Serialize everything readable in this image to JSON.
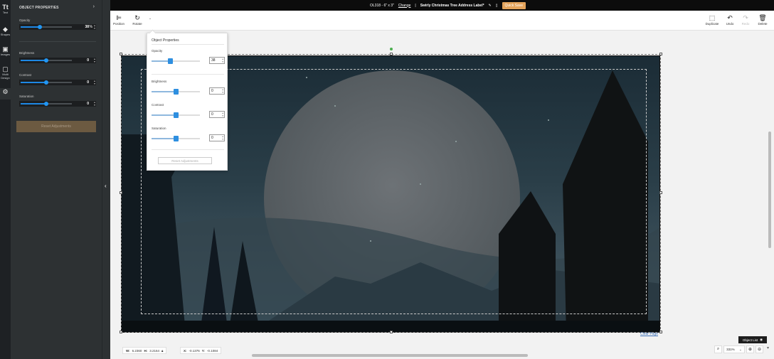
{
  "topbar": {
    "product_code": "OL318 - 6\" x 3\"",
    "change_label": "Change",
    "separator": "|",
    "design_title": "Swirly Christmas Tree Address Label*",
    "quick_save_label": "Quick Save"
  },
  "rail": {
    "items": [
      {
        "label": "Text",
        "icon": "Tt"
      },
      {
        "label": "Shapes",
        "icon": "shapes-icon"
      },
      {
        "label": "Images",
        "icon": "image-icon"
      },
      {
        "label": "Multi Design",
        "icon": "page-icon"
      },
      {
        "label": "",
        "icon": "gear-icon"
      }
    ]
  },
  "panel": {
    "header": "OBJECT PROPERTIES",
    "opacity": {
      "label": "Opacity",
      "value": "38",
      "unit": "%",
      "level": 0.38
    },
    "brightness": {
      "label": "Brightness",
      "value": "0",
      "level": 0.5
    },
    "contrast": {
      "label": "Contrast",
      "value": "0",
      "level": 0.5
    },
    "saturation": {
      "label": "Saturation",
      "value": "0",
      "level": 0.5
    },
    "reset_label": "Reset Adjustments"
  },
  "toolbar": {
    "position_label": "Position",
    "rotate_label": "Rotate",
    "duplicate_label": "Duplicate",
    "undo_label": "Undo",
    "redo_label": "Redo",
    "delete_label": "Delete"
  },
  "popup": {
    "header": "Object Properties",
    "opacity": {
      "label": "Opacity",
      "value": "38",
      "level": 0.38
    },
    "brightness": {
      "label": "Brightness",
      "value": "0",
      "level": 0.5
    },
    "contrast": {
      "label": "Contrast",
      "value": "0",
      "level": 0.5
    },
    "saturation": {
      "label": "Saturation",
      "value": "0",
      "level": 0.5
    },
    "reset_label": "Reset Adjustments"
  },
  "canvas": {
    "clear_page_label": "Clear Page"
  },
  "footer": {
    "w_label": "W:",
    "w_value": "6.2360",
    "h_label": "H:",
    "h_value": "3.2164",
    "x_label": "X:",
    "x_value": "-0.1376",
    "y_label": "Y:",
    "y_value": "-0.1084",
    "object_list_label": "Object List",
    "zoom_value": "331%"
  },
  "colors": {
    "accent_blue": "#2196f3",
    "quick_save": "#e3a35b",
    "panel_bg": "#2d3133"
  }
}
